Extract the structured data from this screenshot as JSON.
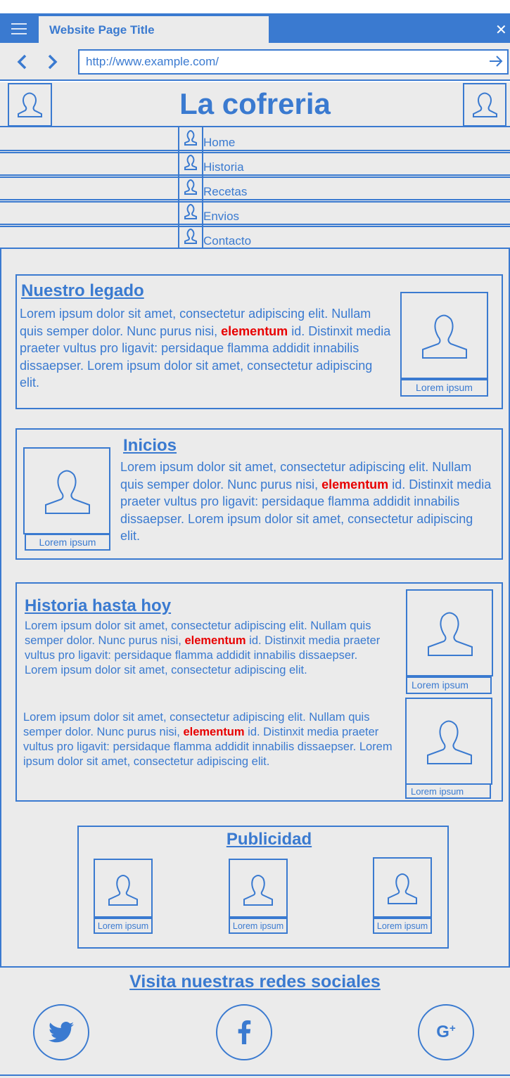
{
  "browser": {
    "tab_title": "Website Page Title",
    "url": "http://www.example.com/"
  },
  "header": {
    "site_title": "La cofreria"
  },
  "nav": {
    "items": [
      {
        "label": "Home"
      },
      {
        "label": "Historia"
      },
      {
        "label": "Recetas"
      },
      {
        "label": "Envios"
      },
      {
        "label": "Contacto"
      }
    ]
  },
  "sections": {
    "legado": {
      "title": "Nuestro legado",
      "text_before": "Lorem ipsum dolor sit amet, consectetur adipiscing elit. Nullam quis semper dolor. Nunc purus nisi,",
      "highlight": "elementum",
      "text_after": " id. Distinxit  media praeter vultus pro ligavit: persidaque flamma addidit innabilis dissaepser. Lorem ipsum dolor sit amet, consectetur adipiscing elit.",
      "image_caption": "Lorem ipsum"
    },
    "inicios": {
      "title": "Inicios",
      "text_before": "Lorem ipsum dolor sit amet, consectetur adipiscing elit. Nullam quis semper dolor. Nunc purus nisi,",
      "highlight": "elementum",
      "text_after": " id. Distinxit  media praeter vultus pro ligavit: persidaque flamma addidit innabilis dissaepser. Lorem ipsum dolor sit amet, consectetur adipiscing elit.",
      "image_caption": "Lorem ipsum"
    },
    "historia": {
      "title": "Historia hasta hoy",
      "p1_before": "Lorem ipsum dolor sit amet, consectetur adipiscing elit. Nullam quis semper dolor. Nunc purus nisi,",
      "p1_highlight": "elementum",
      "p1_after": " id. Distinxit  media praeter vultus pro ligavit: persidaque flamma addidit innabilis dissaepser. Lorem ipsum dolor sit amet, consectetur adipiscing elit.",
      "p2_before": "Lorem ipsum dolor sit amet, consectetur adipiscing elit. Nullam quis semper dolor. Nunc purus nisi,",
      "p2_highlight": "elementum",
      "p2_after": " id. Distinxit  media praeter vultus pro ligavit: persidaque flamma addidit innabilis dissaepser. Lorem ipsum dolor sit amet, consectetur adipiscing elit.",
      "image1_caption": "Lorem ipsum",
      "image2_caption": "Lorem ipsum"
    },
    "publicidad": {
      "title": "Publicidad",
      "ads": [
        {
          "caption": "Lorem ipsum"
        },
        {
          "caption": "Lorem ipsum"
        },
        {
          "caption": "Lorem ipsum"
        }
      ]
    }
  },
  "footer": {
    "title": "Visita nuestras redes sociales",
    "social": [
      {
        "icon": "twitter-icon"
      },
      {
        "icon": "facebook-icon"
      },
      {
        "icon": "google-plus-icon"
      }
    ]
  },
  "colors": {
    "accent": "#3a7ad0",
    "highlight": "#e80000",
    "background": "#ebebeb"
  }
}
